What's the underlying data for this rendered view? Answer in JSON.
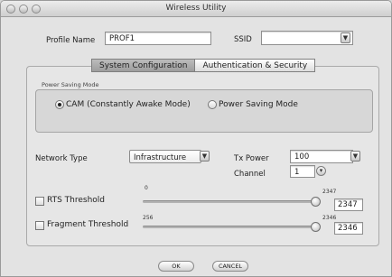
{
  "window": {
    "title": "Wireless Utility"
  },
  "profile": {
    "label": "Profile Name",
    "value": "PROF1",
    "ssid_label": "SSID",
    "ssid_value": ""
  },
  "tabs": [
    {
      "label": "System Configuration",
      "active": true
    },
    {
      "label": "Authentication & Security",
      "active": false
    }
  ],
  "power_saving": {
    "group_title": "Power Saving Mode",
    "options": [
      {
        "label": "CAM (Constantly Awake Mode)",
        "selected": true
      },
      {
        "label": "Power Saving Mode",
        "selected": false
      }
    ]
  },
  "network": {
    "label": "Network Type",
    "value": "Infrastructure"
  },
  "tx_power": {
    "label": "Tx Power",
    "value": "100"
  },
  "channel": {
    "label": "Channel",
    "value": "1"
  },
  "rts": {
    "label": "RTS Threshold",
    "checked": false,
    "min": "0",
    "max": "2347",
    "value": "2347"
  },
  "fragment": {
    "label": "Fragment Threshold",
    "checked": false,
    "min": "256",
    "max": "2346",
    "value": "2346"
  },
  "buttons": {
    "ok": "OK",
    "cancel": "CANCEL"
  },
  "icons": {
    "popup_arrow": "chevron-down-icon",
    "stepper_arrow": "chevron-down-icon"
  }
}
